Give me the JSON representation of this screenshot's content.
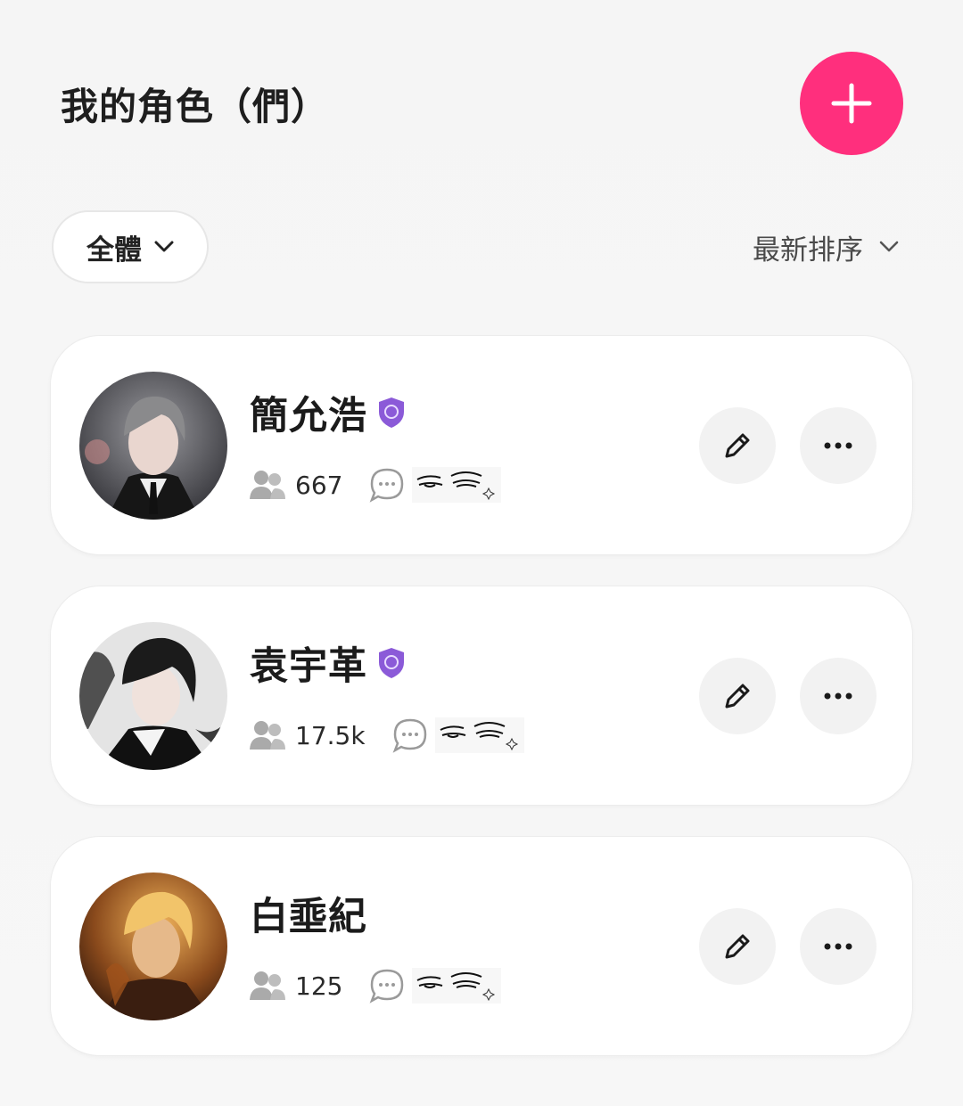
{
  "header": {
    "title": "我的角色（們）",
    "add_icon": "plus-icon",
    "accent_color": "#ff2f7d"
  },
  "filter": {
    "label": "全體",
    "icon": "chevron-down-icon"
  },
  "sort": {
    "label": "最新排序",
    "icon": "chevron-down-icon"
  },
  "characters": [
    {
      "name": "簡允浩",
      "verified": true,
      "followers": "667",
      "avatar_theme": "grey-haired man in suit"
    },
    {
      "name": "袁宇革",
      "verified": true,
      "followers": "17.5k",
      "avatar_theme": "dark-haired man in black and white"
    },
    {
      "name": "白埀紀",
      "verified": false,
      "followers": "125",
      "avatar_theme": "golden-haired man in warm light"
    }
  ],
  "icons": {
    "verified": "shield-badge-icon",
    "followers": "people-icon",
    "chat": "chat-bubble-icon",
    "edit": "pencil-icon",
    "more": "more-horizontal-icon"
  }
}
